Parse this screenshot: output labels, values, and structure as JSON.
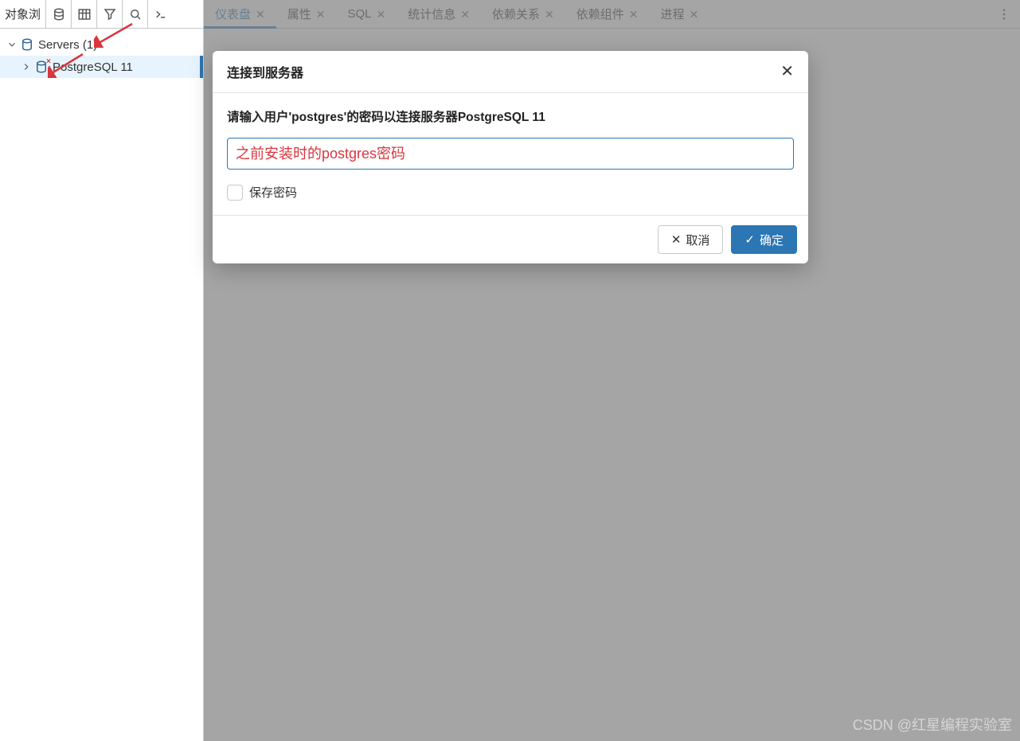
{
  "sidebar": {
    "title": "对象浏",
    "tree": {
      "root_label": "Servers (1)",
      "child_label": "PostgreSQL 11"
    }
  },
  "tabs": [
    {
      "label": "仪表盘",
      "active": true
    },
    {
      "label": "属性",
      "active": false
    },
    {
      "label": "SQL",
      "active": false
    },
    {
      "label": "统计信息",
      "active": false
    },
    {
      "label": "依赖关系",
      "active": false
    },
    {
      "label": "依赖组件",
      "active": false
    },
    {
      "label": "进程",
      "active": false
    }
  ],
  "dialog": {
    "title": "连接到服务器",
    "prompt": "请输入用户'postgres'的密码以连接服务器PostgreSQL 11",
    "password_annotation": "之前安装时的postgres密码",
    "save_password_label": "保存密码",
    "cancel_label": "取消",
    "ok_label": "确定"
  },
  "watermark": "CSDN @红星编程实验室"
}
